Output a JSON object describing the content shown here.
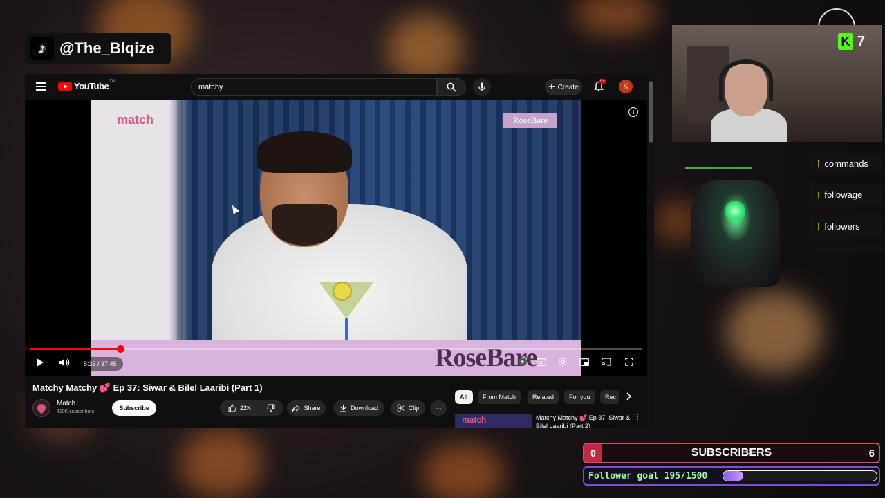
{
  "overlay": {
    "tiktok_handle": "@The_Blqize",
    "kick_count": "7",
    "commands": [
      "commands",
      "followage",
      "followers"
    ],
    "subscribers": {
      "left_count": "0",
      "label": "SUBSCRIBERS",
      "right_count": "6"
    },
    "follower_goal": {
      "text": "Follower goal 195/1500",
      "current": 195,
      "target": 1500,
      "progress": 0.13
    }
  },
  "youtube": {
    "logo_text": "YouTube",
    "logo_sup": "TN",
    "search_value": "matchy",
    "create_label": "Create",
    "notification_badge": "9+",
    "avatar_letter": "K",
    "video": {
      "brand_left": "match",
      "brand_badge": "RoseBare",
      "brand_big": "RoseBare",
      "time": "5:33 / 37:45",
      "progress": 0.147
    },
    "title": "Matchy Matchy 💕 Ep 37: Siwar & Bilel Laaribi (Part 1)",
    "channel_name": "Match",
    "channel_subs": "410K subscribers",
    "subscribe_label": "Subscribe",
    "likes": "22K",
    "share_label": "Share",
    "download_label": "Download",
    "clip_label": "Clip",
    "more_label": "···",
    "chips": [
      "All",
      "From Match",
      "Related",
      "For you",
      "Rec"
    ],
    "recommendation": {
      "thumb_text": "match",
      "title": "Matchy Matchy 💕 Ep 37: Siwar & Bilel Laaribi (Part 2)"
    }
  },
  "colors": {
    "accent_red": "#ff0000",
    "match_pink": "#d9547c",
    "kick_green": "#53fc18",
    "goal_purple": "#8a5cf0"
  }
}
